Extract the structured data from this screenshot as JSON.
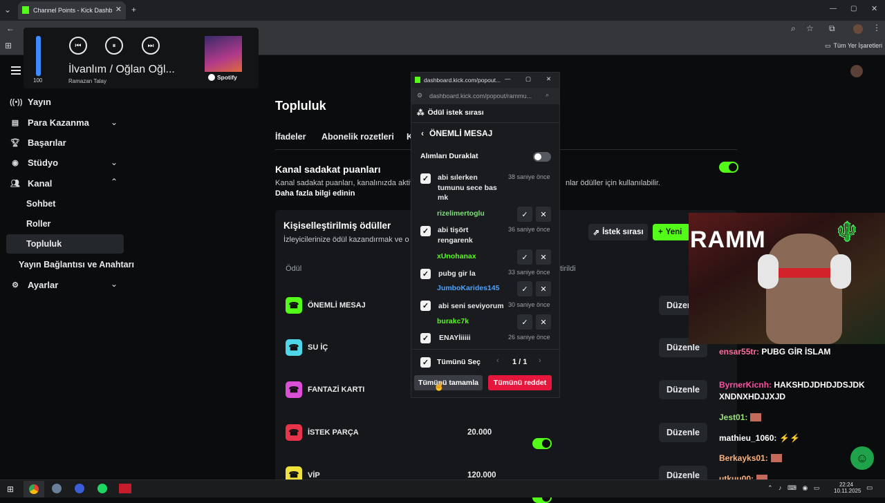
{
  "browser": {
    "tab_title": "Channel Points - Kick Dashboard",
    "bookmark_label": "Tüm Yer İşaretleri"
  },
  "media": {
    "volume": "100",
    "track": "İlvanlım / Oğlan Oğl...",
    "artist": "Ramazan Talay",
    "source": "Spotify"
  },
  "sidebar": {
    "items": [
      {
        "label": "Yayın",
        "icon": "broadcast-icon"
      },
      {
        "label": "Para Kazanma",
        "icon": "chart-icon"
      },
      {
        "label": "Başarılar",
        "icon": "trophy-icon"
      },
      {
        "label": "Stüdyo",
        "icon": "camera-icon"
      },
      {
        "label": "Kanal",
        "icon": "users-icon"
      }
    ],
    "sub_items": [
      "Sohbet",
      "Roller",
      "Topluluk"
    ],
    "more": "Yayın Bağlantısı ve Anahtarı",
    "settings": "Ayarlar"
  },
  "main": {
    "title": "Topluluk",
    "tabs": [
      "İfadeler",
      "Abonelik rozetleri",
      "K"
    ],
    "loyalty_title": "Kanal sadakat puanları",
    "loyalty_desc": "Kanal sadakat puanları, kanalınızda aktif",
    "loyalty_desc_right": "nlar ödüller için kullanılabilir.",
    "learn_more": "Daha fazla bilgi edinin",
    "rewards_title": "Kişiselleştirilmiş ödüller",
    "rewards_desc": "İzleyicilerinize ödül kazandırmak ve o",
    "queue_button": "İstek sırası",
    "new_button": "Yeni",
    "col_reward": "Ödül",
    "col_enabled": "tirildi",
    "edit_label": "Düzenle",
    "rows": [
      {
        "label": "ÖNEMLİ MESAJ",
        "color": "#53fc18",
        "cost": ""
      },
      {
        "label": "SU İÇ",
        "color": "#4fd6e8",
        "cost": ""
      },
      {
        "label": "FANTAZİ KARTI",
        "color": "#d94fd6",
        "cost": ""
      },
      {
        "label": "İSTEK PARÇA",
        "color": "#e8344a",
        "cost": "20.000"
      },
      {
        "label": "VİP",
        "color": "#f0e03c",
        "cost": "120.000"
      }
    ]
  },
  "popout": {
    "window_title": "dashboard.kick.com/popout...",
    "url": "dashboard.kick.com/popout/rammu...",
    "queue_title": "Ödül istek sırası",
    "reward_name": "ÖNEMLİ MESAJ",
    "pause_label": "Alımları Duraklat",
    "requests": [
      {
        "text": "abi sılerken tumunu sece bas mk",
        "time": "38 saniye önce",
        "user": "rizelimertoglu",
        "user_color": "#7ee07a"
      },
      {
        "text": "abi tişört rengarenk",
        "time": "36 saniye önce",
        "user": "xUnohanax",
        "user_color": "#53fc18"
      },
      {
        "text": "pubg gir la",
        "time": "33 saniye önce",
        "user": "JumboKarides145",
        "user_color": "#4aa3ff"
      },
      {
        "text": "abi seni seviyorum",
        "time": "30 saniye önce",
        "user": "burakc7k",
        "user_color": "#53fc18"
      },
      {
        "text": "ENAYİiiiii",
        "time": "26 saniye önce",
        "user": "",
        "user_color": "#53fc18"
      }
    ],
    "select_all": "Tümünü Seç",
    "pagination": "1 / 1",
    "complete_all": "Tümünü tamamla",
    "reject_all": "Tümünü reddet"
  },
  "stream": {
    "overlay_text": "RAMM"
  },
  "chat": {
    "messages": [
      {
        "user": "ensar55tr:",
        "text": "PUBG GİR İSLAM",
        "color": "#ff6b9a"
      },
      {
        "user": "ByrnerKicnh:",
        "text": "HAKSHDJDHDJDSJDK XNDNXHDJJXJD",
        "color": "#ff4fa3"
      },
      {
        "user": "Jest01:",
        "text": "",
        "color": "#9be37a"
      },
      {
        "user": "mathieu_1060:",
        "text": "",
        "color": "#ffffff"
      },
      {
        "user": "Berkayks01:",
        "text": "",
        "color": "#ffb37a"
      },
      {
        "user": "utkuu00:",
        "text": "",
        "color": "#ffb37a"
      }
    ]
  },
  "taskbar": {
    "time": "22:24",
    "date": "10.11.2025"
  }
}
